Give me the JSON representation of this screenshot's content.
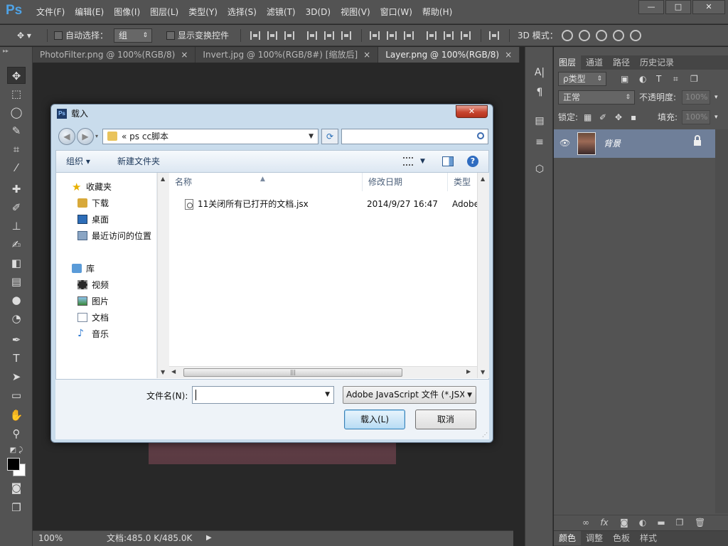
{
  "app": {
    "logo": "Ps",
    "menus": [
      "文件(F)",
      "编辑(E)",
      "图像(I)",
      "图层(L)",
      "类型(Y)",
      "选择(S)",
      "滤镜(T)",
      "3D(D)",
      "视图(V)",
      "窗口(W)",
      "帮助(H)"
    ],
    "window_controls": {
      "minimize": "—",
      "maximize": "□",
      "close": "✕"
    }
  },
  "options": {
    "auto_select_label": "自动选择：",
    "auto_select_value": "组",
    "show_transform_label": "显示变换控件",
    "mode_3d_label": "3D 模式："
  },
  "tabs": [
    {
      "label": "PhotoFilter.png @ 100%(RGB/8)",
      "close": "×"
    },
    {
      "label": "Invert.jpg @ 100%(RGB/8#) [缩放后]",
      "close": "×"
    },
    {
      "label": "Layer.png @ 100%(RGB/8)",
      "close": "×"
    }
  ],
  "status": {
    "zoom": "100%",
    "doc_info": "文档:485.0 K/485.0K",
    "arrow": "▶"
  },
  "layers_panel": {
    "tabs": [
      "图层",
      "通道",
      "路径",
      "历史记录"
    ],
    "filter_kind": "ρ类型",
    "blend_mode": "正常",
    "opacity_label": "不透明度:",
    "opacity_value": "100%",
    "lock_label": "锁定:",
    "fill_label": "填充:",
    "fill_value": "100%",
    "layer_name": "背景",
    "footer_icons": [
      "link-icon",
      "fx-icon",
      "mask-icon",
      "adjustment-icon",
      "group-icon",
      "new-layer-icon",
      "trash-icon"
    ]
  },
  "bottom_panel": {
    "tabs": [
      "颜色",
      "调整",
      "色板",
      "样式"
    ]
  },
  "dialog": {
    "title": "载入",
    "close": "✕",
    "address": "«  ps cc脚本",
    "toolbar": {
      "organize": "组织 ▾",
      "new_folder": "新建文件夹"
    },
    "nav": {
      "favorites": "收藏夹",
      "downloads": "下载",
      "desktop": "桌面",
      "recent": "最近访问的位置",
      "libraries": "库",
      "videos": "视频",
      "pictures": "图片",
      "documents": "文档",
      "music": "音乐"
    },
    "columns": {
      "name": "名称",
      "modified": "修改日期",
      "type": "类型"
    },
    "files": [
      {
        "name": "11关闭所有已打开的文档.jsx",
        "modified": "2014/9/27 16:47",
        "type": "Adobe"
      }
    ],
    "filename_label": "文件名(N):",
    "filename_value": "",
    "filetype": "Adobe JavaScript 文件 (*.JSX",
    "open_button": "载入(L)",
    "cancel_button": "取消"
  },
  "colors": {
    "chrome": "#535353",
    "canvas": "#282828",
    "selected_layer": "#6f7f99",
    "dialog_frame": "#c9dcec"
  }
}
